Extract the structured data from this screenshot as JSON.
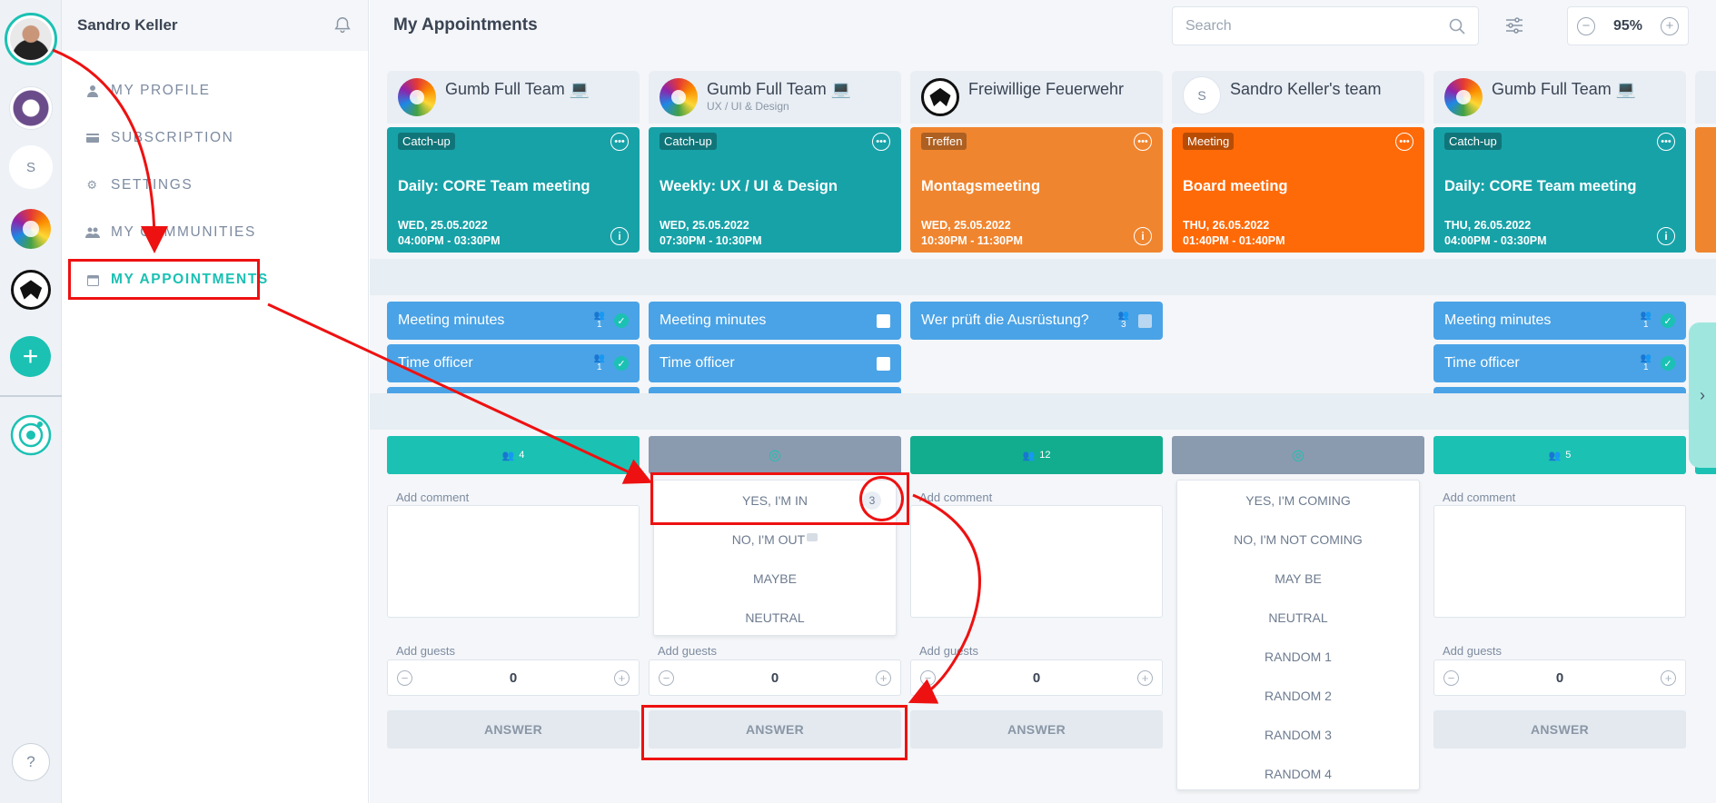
{
  "rail": {
    "s_initial": "S",
    "add_symbol": "+",
    "help_symbol": "?"
  },
  "menu": {
    "user_name": "Sandro Keller",
    "items": [
      {
        "label": "MY PROFILE",
        "icon": "person-icon"
      },
      {
        "label": "SUBSCRIPTION",
        "icon": "credit-card-icon"
      },
      {
        "label": "SETTINGS",
        "icon": "gear-icon"
      },
      {
        "label": "MY COMMUNITIES",
        "icon": "people-icon"
      },
      {
        "label": "MY APPOINTMENTS",
        "icon": "calendar-icon",
        "active": true
      }
    ]
  },
  "header": {
    "title": "My Appointments",
    "search_placeholder": "Search",
    "zoom": "95%"
  },
  "columns": [
    {
      "team": "Gumb Full Team 💻",
      "team_sub": "",
      "tag": "Catch-up",
      "title": "Daily: CORE Team meeting",
      "date": "WED, 25.05.2022",
      "time": "04:00PM - 03:30PM",
      "tasks": [
        {
          "label": "Meeting minutes",
          "count": "1",
          "state": "check"
        },
        {
          "label": "Time officer",
          "count": "1",
          "state": "check"
        }
      ],
      "attendees": "4",
      "comment_label": "Add comment",
      "guests_label": "Add guests",
      "guests": "0",
      "answer": "ANSWER"
    },
    {
      "team": "Gumb Full Team 💻",
      "team_sub": "UX / UI & Design",
      "tag": "Catch-up",
      "title": "Weekly: UX / UI & Design",
      "date": "WED, 25.05.2022",
      "time": "07:30PM - 10:30PM",
      "tasks": [
        {
          "label": "Meeting minutes",
          "state": "box"
        },
        {
          "label": "Time officer",
          "state": "box"
        }
      ],
      "options": [
        "YES, I'M IN",
        "NO, I'M OUT",
        "MAYBE",
        "NEUTRAL"
      ],
      "yes_count": "3",
      "guests_label": "Add guests",
      "guests": "0",
      "answer": "ANSWER"
    },
    {
      "team": "Freiwillige Feuerwehr",
      "team_sub": "",
      "tag": "Treffen",
      "title": "Montagsmeeting",
      "date": "WED, 25.05.2022",
      "time": "10:30PM - 11:30PM",
      "tasks": [
        {
          "label": "Wer prüft die Ausrüstung?",
          "count": "3",
          "state": "box-dim"
        }
      ],
      "attendees": "12",
      "comment_label": "Add comment",
      "guests_label": "Add guests",
      "guests": "0",
      "answer": "ANSWER"
    },
    {
      "team": "Sandro Keller's team",
      "team_initial": "S",
      "team_sub": "",
      "tag": "Meeting",
      "title": "Board meeting",
      "date": "THU, 26.05.2022",
      "time": "01:40PM - 01:40PM",
      "options": [
        "YES, I'M COMING",
        "NO, I'M NOT COMING",
        "MAY BE",
        "NEUTRAL",
        "RANDOM 1",
        "RANDOM 2",
        "RANDOM 3",
        "RANDOM 4"
      ]
    },
    {
      "team": "Gumb Full Team 💻",
      "team_sub": "",
      "tag": "Catch-up",
      "title": "Daily: CORE Team meeting",
      "date": "THU, 26.05.2022",
      "time": "04:00PM - 03:30PM",
      "tasks": [
        {
          "label": "Meeting minutes",
          "count": "1",
          "state": "check"
        },
        {
          "label": "Time officer",
          "count": "1",
          "state": "check"
        }
      ],
      "attendees": "5",
      "comment_label": "Add comment",
      "guests_label": "Add guests",
      "guests": "0",
      "answer": "ANSWER"
    }
  ],
  "colors": {
    "accent": "#1bc1b3",
    "teal_event": "#17a2a8",
    "orange_event": "#f0852f",
    "orange_event_2": "#ff6a08",
    "task_blue": "#4aa3e6",
    "annotation_red": "#ee1111"
  }
}
